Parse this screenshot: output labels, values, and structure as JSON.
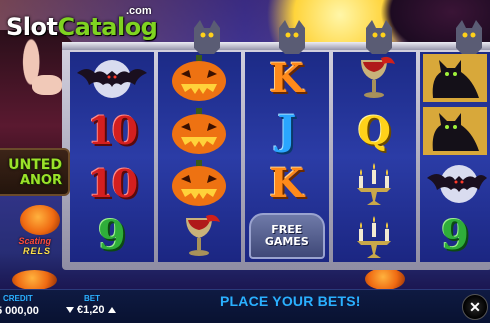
{
  "logo": {
    "part1": "Slot",
    "part2": "Catalog",
    "suffix": ".com"
  },
  "game_title": {
    "line1": "UNTED",
    "line2": "ANOR",
    "sub_line1": "Scating",
    "sub_line2": "RELS"
  },
  "reels": [
    [
      "bat",
      "10",
      "10",
      "9"
    ],
    [
      "pumpkin",
      "pumpkin",
      "pumpkin",
      "goblet"
    ],
    [
      "K",
      "J",
      "K",
      "bonus"
    ],
    [
      "goblet",
      "Q",
      "candelabra",
      "candelabra"
    ],
    [
      "black-cat",
      "black-cat",
      "bat",
      "9"
    ]
  ],
  "bonus_symbol": {
    "line1": "FREE",
    "line2": "GAMES"
  },
  "bottom_bar": {
    "credit_label": "CREDIT",
    "credit_value": "5 000,00",
    "bet_label": "BET",
    "bet_value": "€1,20",
    "status_message": "PLACE YOUR BETS!"
  },
  "colors": {
    "reel_bg": "#2b3ca6",
    "frame": "#c9c7d6",
    "label_blue": "#2ab0ff",
    "logo_green": "#7fd321"
  }
}
